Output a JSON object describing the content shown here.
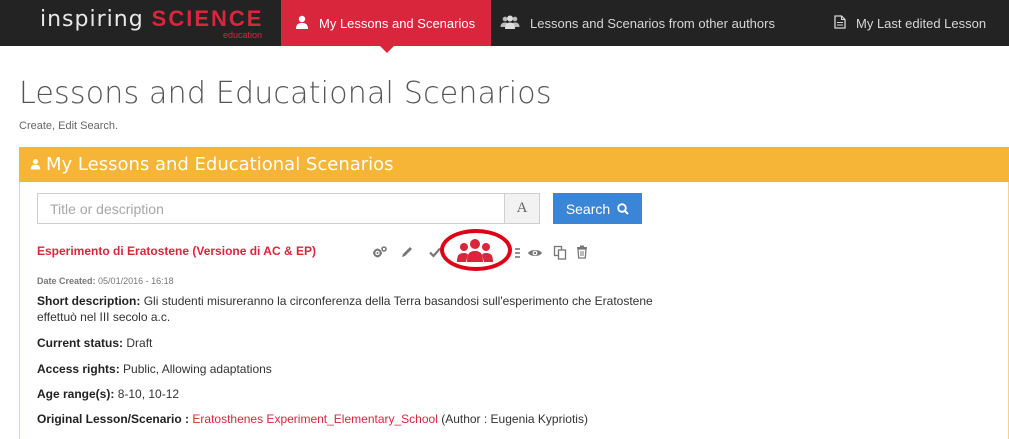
{
  "navbar": {
    "logo_main": "inspiring",
    "logo_accent": "SCIENCE",
    "logo_sub": "education",
    "items": [
      {
        "label": "My Lessons and Scenarios",
        "icon": "user-icon",
        "active": true
      },
      {
        "label": "Lessons and Scenarios from other authors",
        "icon": "users-group-icon",
        "active": false
      },
      {
        "label": "My Last edited Lesson",
        "icon": "document-icon",
        "active": false
      }
    ]
  },
  "page": {
    "title": "Lessons and Educational Scenarios",
    "subtitle": "Create, Edit Search."
  },
  "panel": {
    "title": "My Lessons and Educational Scenarios",
    "title_icon": "user-icon"
  },
  "search": {
    "placeholder": "Title or description",
    "value": "",
    "addon_label": "A",
    "button_label": "Search"
  },
  "lesson": {
    "title": "Esperimento di Eratostene (Versione di AC & EP)",
    "actions": [
      "settings-icon",
      "edit-icon",
      "approve-icon",
      "collaborators-icon",
      "sort-icon",
      "view-icon",
      "copy-icon",
      "delete-icon"
    ],
    "date_label": "Date Created:",
    "date_value": "05/01/2016 - 16:18",
    "description_label": "Short description:",
    "description_value": "Gli studenti misureranno la circonferenza della Terra basandosi sull'esperimento che Eratostene effettuò nel III secolo a.c.",
    "status_label": "Current status:",
    "status_value": "Draft",
    "access_label": "Access rights:",
    "access_value": "Public, Allowing adaptations",
    "age_label": "Age range(s):",
    "age_value": "8-10, 10-12",
    "original_label": "Original Lesson/Scenario :",
    "original_link": "Eratosthenes Experiment_Elementary_School",
    "original_author": "(Author : Eugenia Kypriotis)"
  },
  "colors": {
    "navbar_bg": "#232323",
    "brand_red": "#d9263c",
    "panel_orange": "#f7b538",
    "search_blue": "#3a85d6",
    "highlight_red": "#e00018"
  }
}
